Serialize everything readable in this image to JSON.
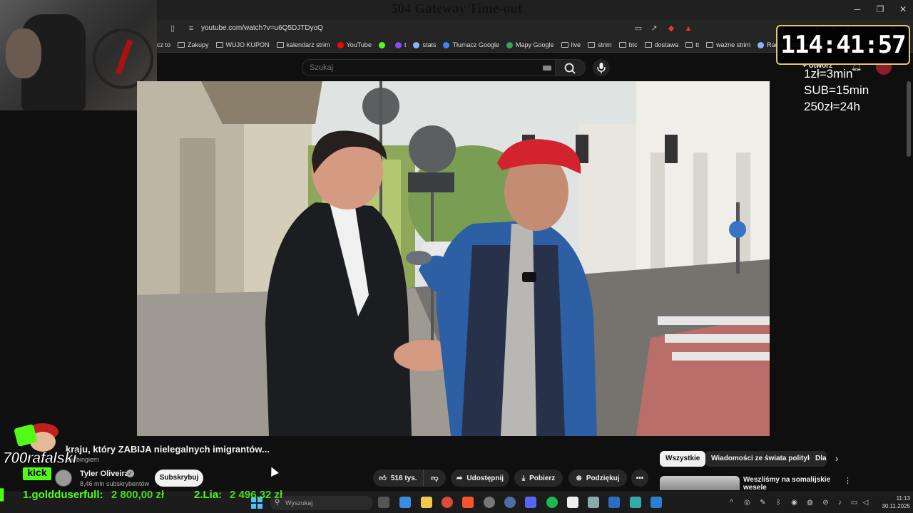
{
  "browser": {
    "tab_title": "504 Gateway Time-out",
    "url": "youtube.com/watch?v=u6Q5DJTDyoQ",
    "bookmarks": [
      {
        "label": "cz to",
        "icon": "text"
      },
      {
        "label": "Zakupy",
        "icon": "folder"
      },
      {
        "label": "WUJO KUPON",
        "icon": "folder"
      },
      {
        "label": "kalendarz strim",
        "icon": "folder"
      },
      {
        "label": "YouTube",
        "icon": "youtube"
      },
      {
        "label": "",
        "icon": "kick"
      },
      {
        "label": "t",
        "icon": "twitch"
      },
      {
        "label": "stats",
        "icon": "link"
      },
      {
        "label": "Tłumacz Google",
        "icon": "translate"
      },
      {
        "label": "Mapy Google",
        "icon": "maps"
      },
      {
        "label": "live",
        "icon": "folder"
      },
      {
        "label": "strim",
        "icon": "folder"
      },
      {
        "label": "btc",
        "icon": "folder"
      },
      {
        "label": "dostawa",
        "icon": "folder"
      },
      {
        "label": "tt",
        "icon": "folder"
      },
      {
        "label": "ważne strim",
        "icon": "folder"
      },
      {
        "label": "Radar opadów",
        "icon": "link"
      }
    ]
  },
  "youtube": {
    "search_placeholder": "Szukaj",
    "create_label": "Utwórz",
    "video_title": "kraju, który ZABIJA nielegalnych imigrantów...",
    "dubbing_text": "dubbingiem",
    "channel_name": "Tyler Oliveira",
    "subscribers": "8,46 mln subskrybentów",
    "subscribe_label": "Subskrybuj",
    "likes": "516 tys.",
    "share_label": "Udostępnij",
    "download_label": "Pobierz",
    "thanks_label": "Podziękuj",
    "chips": [
      "Wszystkie",
      "Wiadomości ze świata polityki",
      "Dla"
    ],
    "rec_title": "Weszliśmy na somalijskie wesele"
  },
  "stream_overlay": {
    "timer": "114:41:57",
    "rates": [
      "1zł=3min",
      "SUB=15min",
      "250zł=24h"
    ],
    "kick_channel": "700rafalski",
    "kick_brand": "kick",
    "ticker": [
      {
        "name": "1.goldduserfull:",
        "amount": "2 800,00 zł"
      },
      {
        "name": "2.Lia:",
        "amount": "2 496,32 zł"
      }
    ]
  },
  "taskbar": {
    "search_placeholder": "Wyszukaj",
    "time": "11:13",
    "date": "30.11.2025"
  }
}
